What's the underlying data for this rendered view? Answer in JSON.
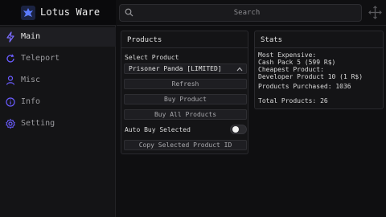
{
  "app": {
    "name": "Lotus Ware",
    "logo_icon": "lotus-icon",
    "accent": "#6a5cff"
  },
  "sidebar": {
    "items": [
      {
        "label": "Main",
        "icon": "lightning-icon",
        "active": true
      },
      {
        "label": "Teleport",
        "icon": "refresh-icon",
        "active": false
      },
      {
        "label": "Misc",
        "icon": "user-icon",
        "active": false
      },
      {
        "label": "Info",
        "icon": "info-icon",
        "active": false
      },
      {
        "label": "Setting",
        "icon": "gear-icon",
        "active": false
      }
    ]
  },
  "search": {
    "placeholder": "Search",
    "value": ""
  },
  "products": {
    "title": "Products",
    "select_label": "Select Product",
    "selected_product": "Prisoner Panda [LIMITED]",
    "refresh_label": "Refresh",
    "buy_product_label": "Buy Product",
    "buy_all_label": "Buy All Products",
    "auto_buy_label": "Auto Buy Selected",
    "auto_buy_enabled": false,
    "copy_id_label": "Copy Selected Product ID"
  },
  "stats": {
    "title": "Stats",
    "most_expensive_label": "Most Expensive:",
    "most_expensive_value": "Cash Pack 5 (599 R$)",
    "cheapest_label": "Cheapest Product:",
    "cheapest_value": "Developer Product 10 (1 R$)",
    "purchased": "Products Purchased: 1036",
    "total": "Total Products: 26"
  }
}
